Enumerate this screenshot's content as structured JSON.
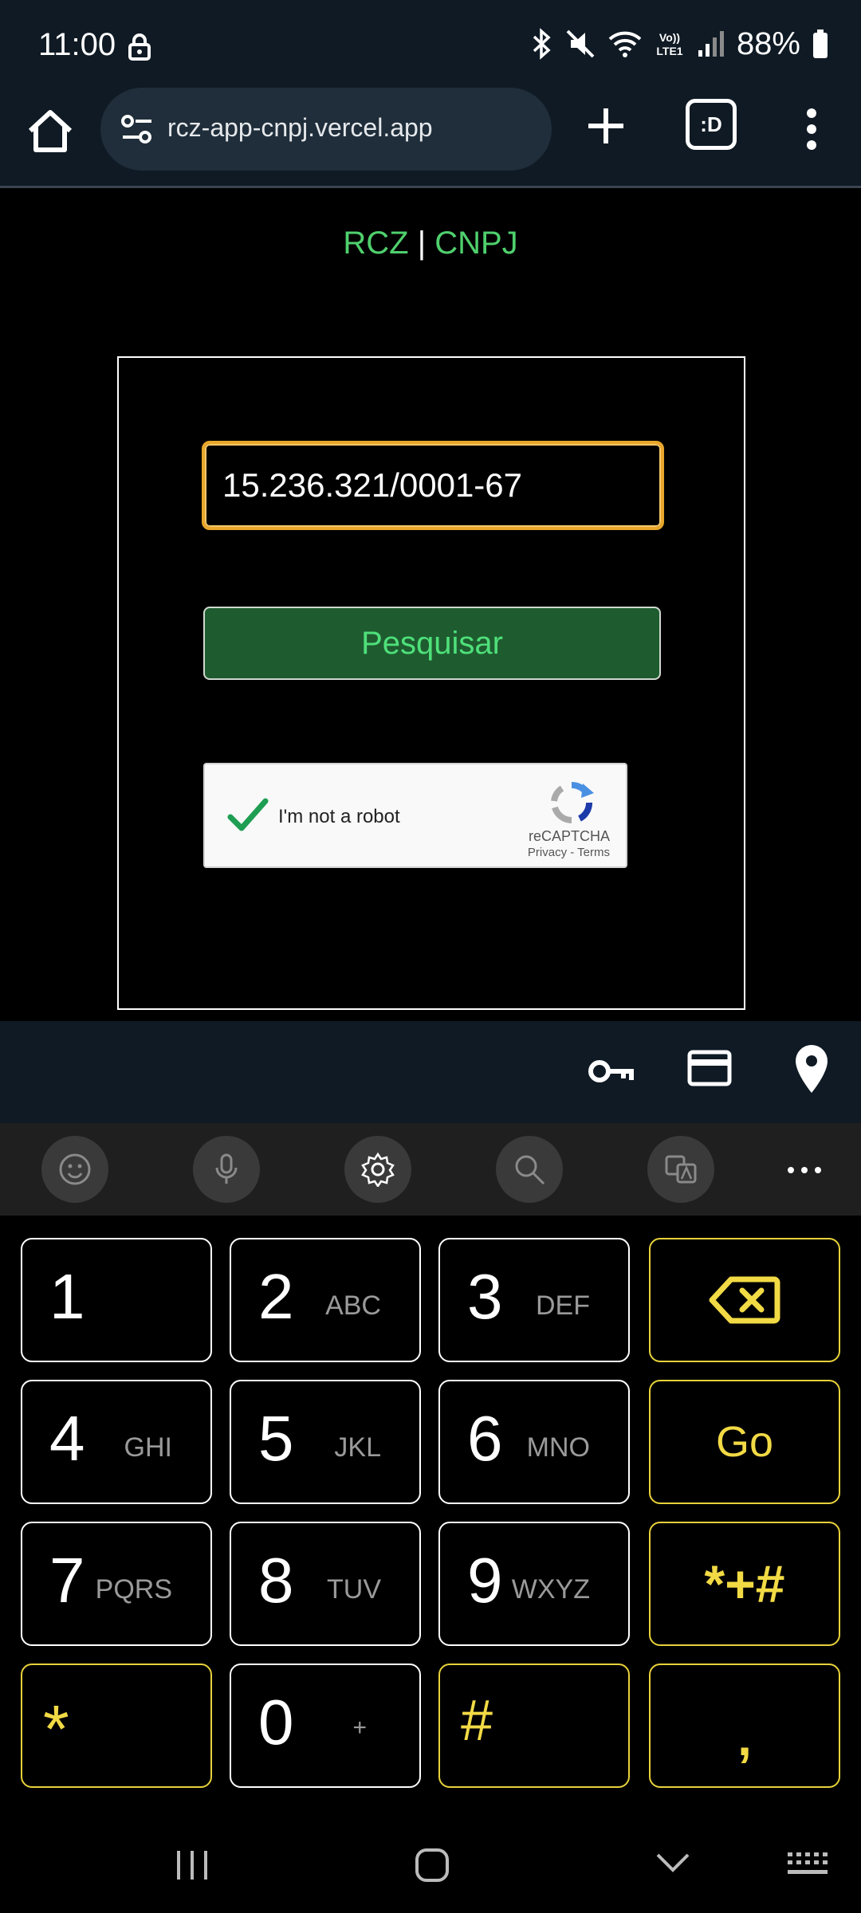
{
  "status_bar": {
    "time": "11:00",
    "battery": "88%",
    "network_badge": "Vo)) LTE1"
  },
  "browser": {
    "url": "rcz-app-cnpj.vercel.app",
    "tabs_label": ":D"
  },
  "page": {
    "brand_left": "RCZ",
    "brand_separator": "|",
    "brand_right": "CNPJ",
    "cnpj_value": "15.236.321/0001-67",
    "search_button_label": "Pesquisar",
    "recaptcha": {
      "label": "I'm not a robot",
      "brand": "reCAPTCHA",
      "links": "Privacy - Terms",
      "checked": true
    }
  },
  "keypad": {
    "keys": [
      {
        "num": "1",
        "letters": ""
      },
      {
        "num": "2",
        "letters": "ABC"
      },
      {
        "num": "3",
        "letters": "DEF"
      },
      {
        "num": "4",
        "letters": "GHI"
      },
      {
        "num": "5",
        "letters": "JKL"
      },
      {
        "num": "6",
        "letters": "MNO"
      },
      {
        "num": "7",
        "letters": "PQRS"
      },
      {
        "num": "8",
        "letters": "TUV"
      },
      {
        "num": "9",
        "letters": "WXYZ"
      },
      {
        "num": "0",
        "letters": "+"
      }
    ],
    "go_label": "Go",
    "symbols_label": "*+#",
    "star_label": "*",
    "hash_label": "#",
    "comma_label": ","
  },
  "colors": {
    "brand_green": "#4fd06d",
    "input_focus": "#e8a72b",
    "button_bg": "#1e5c30",
    "key_accent": "#f2da45"
  }
}
